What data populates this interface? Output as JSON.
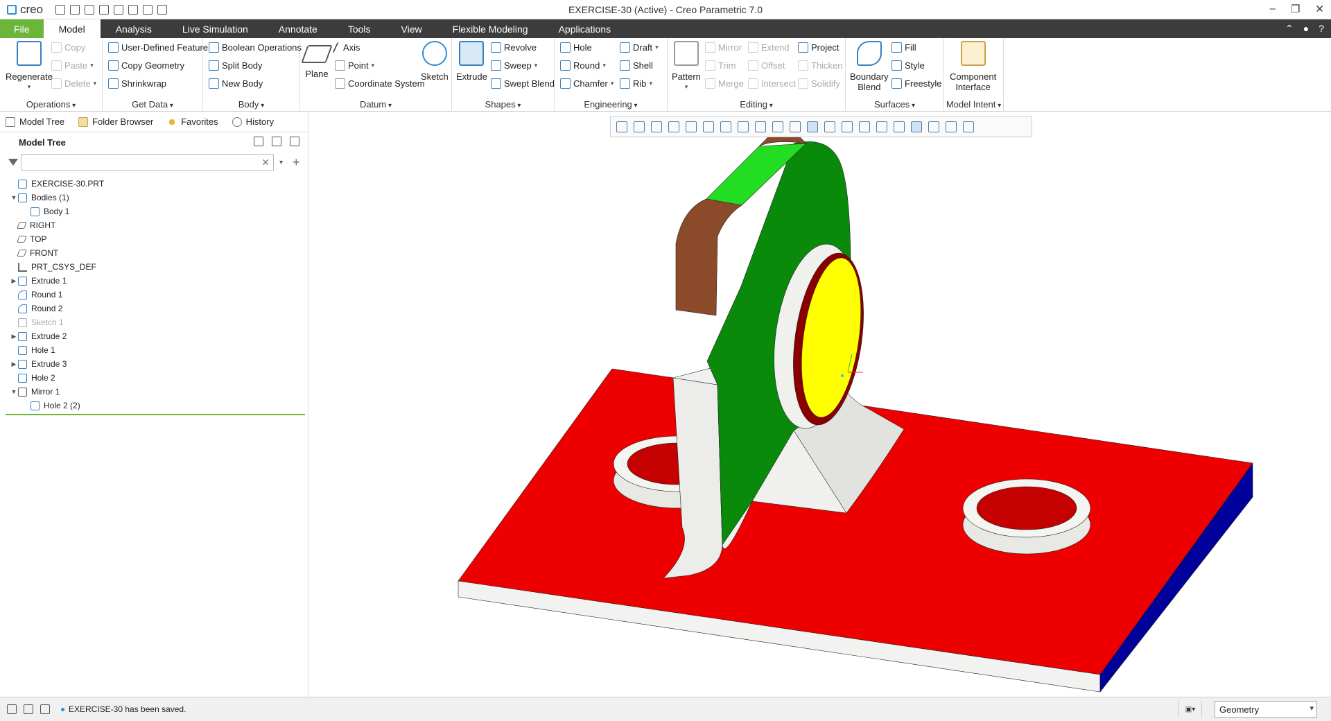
{
  "window": {
    "title": "EXERCISE-30 (Active) - Creo Parametric 7.0",
    "app_logo": "creo",
    "controls": [
      "–",
      "❐",
      "✕"
    ]
  },
  "tabs": [
    {
      "label": "File"
    },
    {
      "label": "Model"
    },
    {
      "label": "Analysis"
    },
    {
      "label": "Live Simulation"
    },
    {
      "label": "Annotate"
    },
    {
      "label": "Tools"
    },
    {
      "label": "View"
    },
    {
      "label": "Flexible Modeling"
    },
    {
      "label": "Applications"
    }
  ],
  "ribbon": {
    "operations": {
      "label": "Operations",
      "regenerate": "Regenerate",
      "copy": "Copy",
      "paste": "Paste",
      "delete": "Delete"
    },
    "get_data": {
      "label": "Get Data",
      "udf": "User-Defined Feature",
      "copy_geometry": "Copy Geometry",
      "shrinkwrap": "Shrinkwrap"
    },
    "body": {
      "label": "Body",
      "boolean": "Boolean Operations",
      "split": "Split Body",
      "new": "New Body"
    },
    "datum": {
      "label": "Datum",
      "plane": "Plane",
      "axis": "Axis",
      "point": "Point",
      "csys": "Coordinate System",
      "sketch": "Sketch"
    },
    "shapes": {
      "label": "Shapes",
      "extrude": "Extrude",
      "revolve": "Revolve",
      "sweep": "Sweep",
      "swept_blend": "Swept Blend"
    },
    "engineering": {
      "label": "Engineering",
      "hole": "Hole",
      "round": "Round",
      "chamfer": "Chamfer",
      "draft": "Draft",
      "shell": "Shell",
      "rib": "Rib"
    },
    "editing": {
      "label": "Editing",
      "pattern": "Pattern",
      "mirror": "Mirror",
      "trim": "Trim",
      "merge": "Merge",
      "extend": "Extend",
      "offset": "Offset",
      "intersect": "Intersect",
      "project": "Project",
      "thicken": "Thicken",
      "solidify": "Solidify"
    },
    "surfaces": {
      "label": "Surfaces",
      "boundary_blend_1": "Boundary",
      "boundary_blend_2": "Blend",
      "fill": "Fill",
      "style": "Style",
      "freestyle": "Freestyle"
    },
    "model_intent": {
      "label": "Model Intent",
      "component_1": "Component",
      "component_2": "Interface"
    }
  },
  "panel": {
    "tabs": [
      "Model Tree",
      "Folder Browser",
      "Favorites",
      "History"
    ],
    "tree_title": "Model Tree",
    "search_placeholder": "",
    "tree": [
      {
        "label": "EXERCISE-30.PRT",
        "level": 0,
        "expander": ""
      },
      {
        "label": "Bodies (1)",
        "level": 0,
        "expander": "▼"
      },
      {
        "label": "Body 1",
        "level": 1,
        "expander": ""
      },
      {
        "label": "RIGHT",
        "level": 0,
        "expander": ""
      },
      {
        "label": "TOP",
        "level": 0,
        "expander": ""
      },
      {
        "label": "FRONT",
        "level": 0,
        "expander": ""
      },
      {
        "label": "PRT_CSYS_DEF",
        "level": 0,
        "expander": ""
      },
      {
        "label": "Extrude 1",
        "level": 0,
        "expander": "▶"
      },
      {
        "label": "Round 1",
        "level": 0,
        "expander": ""
      },
      {
        "label": "Round 2",
        "level": 0,
        "expander": ""
      },
      {
        "label": "Sketch 1",
        "level": 0,
        "expander": ""
      },
      {
        "label": "Extrude 2",
        "level": 0,
        "expander": "▶"
      },
      {
        "label": "Hole 1",
        "level": 0,
        "expander": ""
      },
      {
        "label": "Extrude 3",
        "level": 0,
        "expander": "▶"
      },
      {
        "label": "Hole 2",
        "level": 0,
        "expander": ""
      },
      {
        "label": "Mirror 1",
        "level": 0,
        "expander": "▼"
      },
      {
        "label": "Hole 2 (2)",
        "level": 1,
        "expander": ""
      }
    ]
  },
  "status": {
    "message": "EXERCISE-30 has been saved.",
    "filter_value": "Geometry"
  },
  "colors": {
    "accent_green": "#6bb539",
    "tabbar": "#3c3c3c",
    "face_red": "#ee0000",
    "face_green": "#0a8a0a",
    "face_blue": "#00009a",
    "face_yellow": "#ffff00",
    "face_copper": "#8b4a2a"
  }
}
